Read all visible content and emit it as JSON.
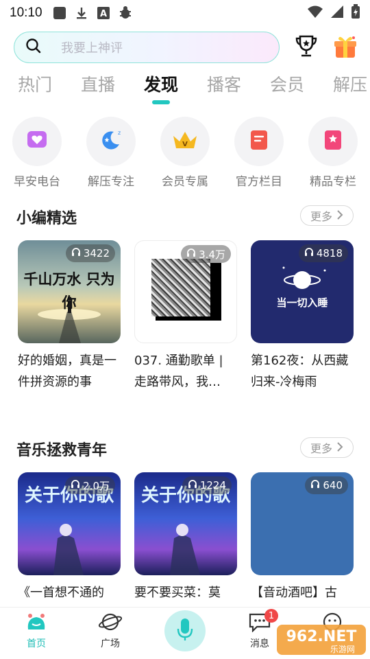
{
  "status_bar": {
    "time": "10:10",
    "icons": [
      "square-notification-icon",
      "download-icon",
      "font-a-icon",
      "bug-icon",
      "wifi-icon",
      "signal-icon",
      "battery-icon"
    ]
  },
  "search": {
    "placeholder": "我要上神评"
  },
  "header_icons": [
    "trophy-icon",
    "gift-icon"
  ],
  "tabs": [
    {
      "label": "热门",
      "active": false
    },
    {
      "label": "直播",
      "active": false
    },
    {
      "label": "发现",
      "active": true
    },
    {
      "label": "播客",
      "active": false
    },
    {
      "label": "会员",
      "active": false
    },
    {
      "label": "解压",
      "active": false
    }
  ],
  "channels": [
    {
      "label": "早安电台",
      "icon": "heart-chat-icon"
    },
    {
      "label": "解压专注",
      "icon": "moon-sleep-icon"
    },
    {
      "label": "会员专属",
      "icon": "crown-icon"
    },
    {
      "label": "官方栏目",
      "icon": "document-icon"
    },
    {
      "label": "精品专栏",
      "icon": "bookmark-star-icon"
    }
  ],
  "section_picks": {
    "title": "小编精选",
    "more": "更多",
    "cards": [
      {
        "title": "好的婚姻，真是一件拼资源的事",
        "plays": "3422",
        "cover_text": "千山万水 只为你"
      },
      {
        "title": "037. 通勤歌单 | 走路带风，我…",
        "plays": "3.4万",
        "cover_text": ""
      },
      {
        "title": "第162夜：从西藏归来-冷梅雨",
        "plays": "4818",
        "cover_text": "当一切入睡"
      }
    ]
  },
  "section_music": {
    "title": "音乐拯救青年",
    "more": "更多",
    "cards": [
      {
        "title": "《一首想不通的",
        "plays": "2.0万",
        "cover_text": "关于你的歌"
      },
      {
        "title": "要不要买菜：莫",
        "plays": "1224",
        "cover_text": "关于你的歌"
      },
      {
        "title": "【音动酒吧】古",
        "plays": "640",
        "cover_text": ""
      }
    ]
  },
  "bottom_nav": {
    "items": [
      {
        "label": "首页",
        "active": true
      },
      {
        "label": "广场",
        "active": false
      },
      {
        "label": "",
        "active": false
      },
      {
        "label": "消息",
        "active": false,
        "badge": "1"
      },
      {
        "label": "",
        "active": false
      }
    ]
  },
  "watermark": {
    "text": "962.NET",
    "subtext": "乐游网"
  },
  "colors": {
    "accent": "#22c7c0",
    "inactive_tab": "#a7a7a7",
    "badge": "#f04848"
  }
}
